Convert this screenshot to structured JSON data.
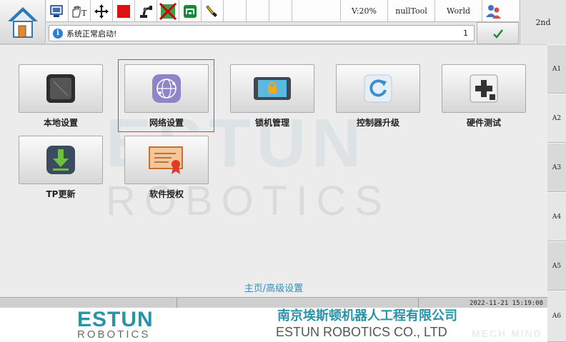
{
  "toolbar": {
    "speed": "V:20%",
    "tool": "nullTool",
    "coord": "World",
    "second": "2nd"
  },
  "message": {
    "text": "系统正常启动!",
    "count": "1"
  },
  "side_tabs": [
    "A1",
    "A2",
    "A3",
    "A4",
    "A5",
    "A6"
  ],
  "tiles": [
    {
      "label": "本地设置"
    },
    {
      "label": "网络设置"
    },
    {
      "label": "锁机管理"
    },
    {
      "label": "控制器升级"
    },
    {
      "label": "硬件测试"
    },
    {
      "label": "TP更新"
    },
    {
      "label": "软件授权"
    }
  ],
  "breadcrumb": "主页/高级设置",
  "status": {
    "datetime": "2022-11-21 15:19:08"
  },
  "watermark": {
    "big": "ESTUN",
    "small": "ROBOTICS"
  },
  "footer": {
    "logo_main": "ESTUN",
    "logo_sub": "ROBOTICS",
    "company_cn": "南京埃斯顿机器人工程有限公司",
    "company_en": "ESTUN ROBOTICS CO., LTD",
    "overlay": "MECH MIND"
  },
  "colors": {
    "accent": "#2993a8",
    "selected_border": "#e23a3a",
    "breadcrumb": "#2d8fbd"
  }
}
